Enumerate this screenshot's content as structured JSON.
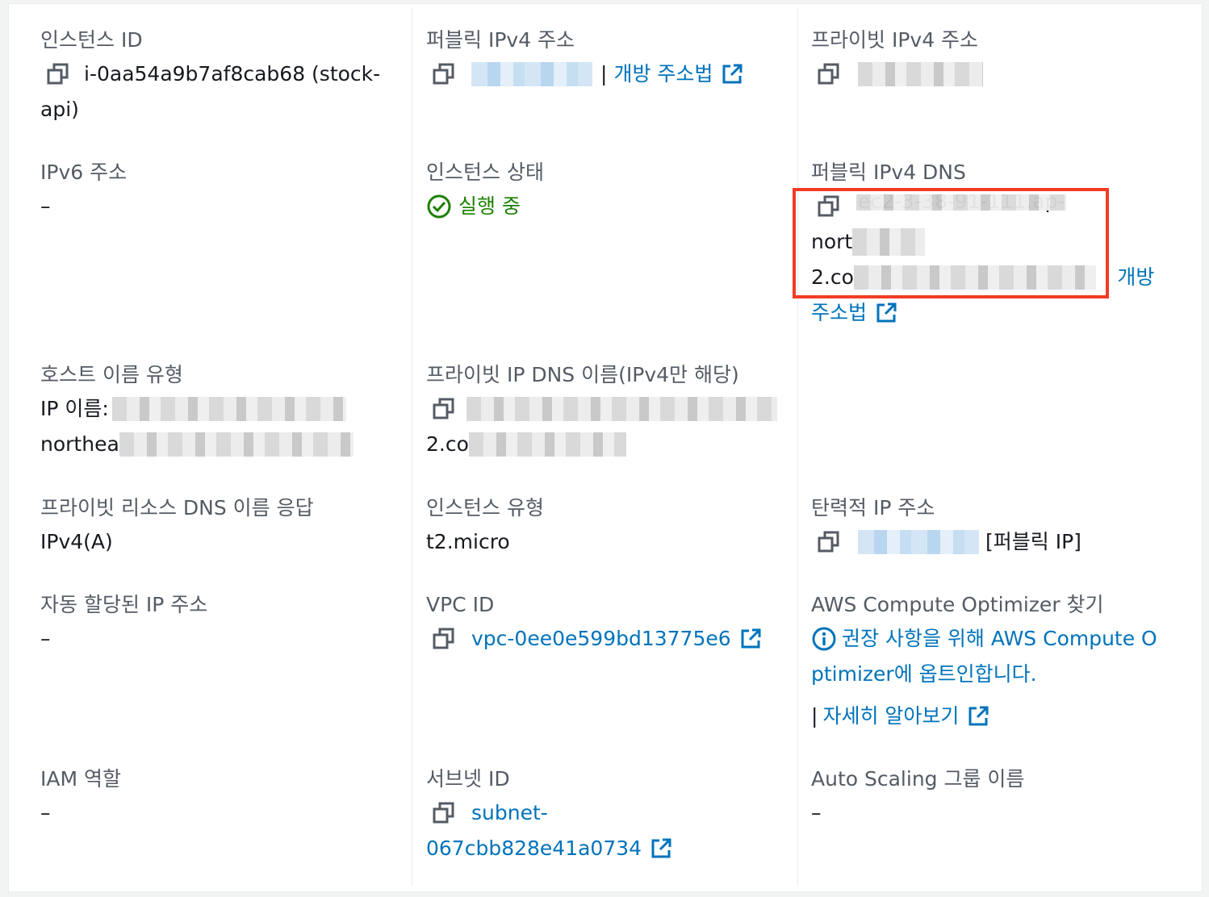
{
  "instance_id": {
    "label": "인스턴스 ID",
    "value_line1": "i-0aa54a9b7af8cab68 (stock-",
    "value_line2": "api)"
  },
  "public_ipv4": {
    "label": "퍼블릭 IPv4 주소",
    "sep": "|",
    "link": "개방 주소법"
  },
  "private_ipv4": {
    "label": "프라이빗 IPv4 주소"
  },
  "ipv6": {
    "label": "IPv6 주소",
    "value": "–"
  },
  "instance_state": {
    "label": "인스턴스 상태",
    "value": "실행 중"
  },
  "public_dns": {
    "label": "퍼블릭 IPv4 DNS",
    "line1": "ec2-3-38-91-111.ap-",
    "line2": "nort",
    "line3": "2.co",
    "sep": "|",
    "link_part1": "개방",
    "link_part2": "주소법"
  },
  "hostname_type": {
    "label": "호스트 이름 유형",
    "line1": "IP 이름:",
    "line2": "northea"
  },
  "private_dns": {
    "label": "프라이빗 IP DNS 이름(IPv4만 해당)",
    "line2": "2.co"
  },
  "resource_dns": {
    "label": "프라이빗 리소스 DNS 이름 응답",
    "value": "IPv4(A)"
  },
  "instance_type": {
    "label": "인스턴스 유형",
    "value": "t2.micro"
  },
  "elastic_ip": {
    "label": "탄력적 IP 주소",
    "suffix": "[퍼블릭 IP]"
  },
  "auto_ip": {
    "label": "자동 할당된 IP 주소",
    "value": "–"
  },
  "vpc_id": {
    "label": "VPC ID",
    "value": "vpc-0ee0e599bd13775e6"
  },
  "compute_optimizer": {
    "label": "AWS Compute Optimizer 찾기",
    "line1": "권장 사항을 위해 AWS Compute O",
    "line2": "ptimizer에 옵트인합니다.",
    "sep": "|",
    "learn_more": "자세히 알아보기"
  },
  "iam_role": {
    "label": "IAM 역할",
    "value": "–"
  },
  "subnet_id": {
    "label": "서브넷 ID",
    "line1": "subnet-",
    "line2": "067cbb828e41a0734"
  },
  "asg_name": {
    "label": "Auto Scaling 그룹 이름",
    "value": "–"
  },
  "colors": {
    "link": "#0073bb",
    "success": "#1d8102",
    "label": "#545b64",
    "highlight": "#f53b24"
  }
}
